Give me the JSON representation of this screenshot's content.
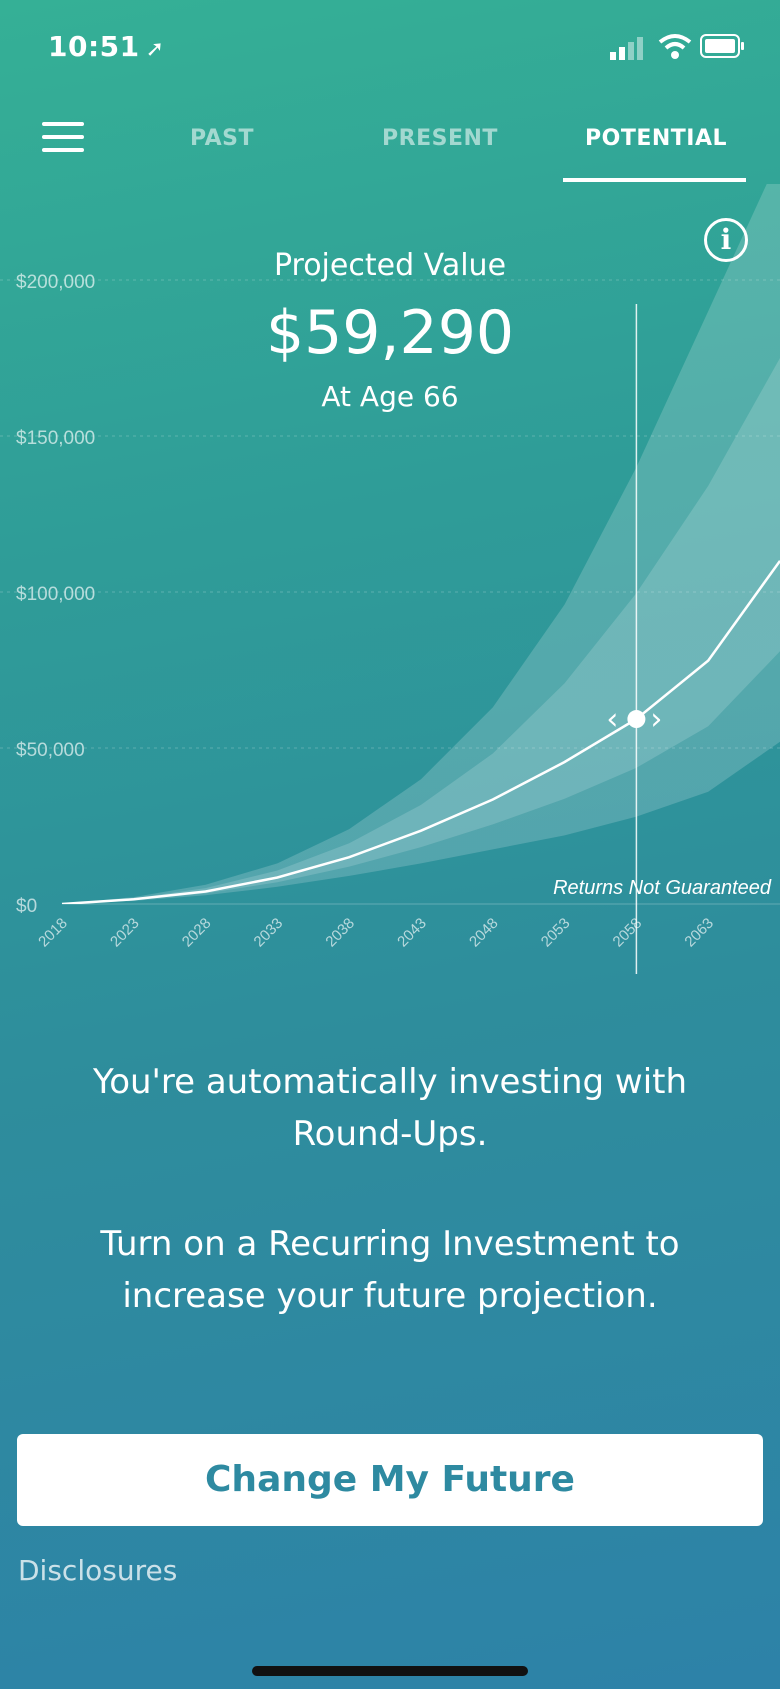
{
  "status_bar": {
    "time": "10:51"
  },
  "nav": {
    "tabs": [
      {
        "label": "PAST",
        "active": false
      },
      {
        "label": "PRESENT",
        "active": false
      },
      {
        "label": "POTENTIAL",
        "active": true
      }
    ]
  },
  "projection": {
    "label": "Projected Value",
    "value": "$59,290",
    "age_text": "At Age 66"
  },
  "chart_data": {
    "type": "area",
    "x_ticks": [
      "2018",
      "2023",
      "2028",
      "2033",
      "2038",
      "2043",
      "2048",
      "2053",
      "2058",
      "2063"
    ],
    "y_ticks": [
      "$0",
      "$50,000",
      "$100,000",
      "$150,000",
      "$200,000"
    ],
    "y_tick_values": [
      0,
      50000,
      100000,
      150000,
      200000
    ],
    "ylim": [
      0,
      200000
    ],
    "xlim": [
      2018,
      2068
    ],
    "selected": {
      "year": 2058,
      "value": 59290
    },
    "annotation": "Returns Not Guaranteed",
    "series": [
      {
        "x": [
          2018,
          2023,
          2028,
          2033,
          2038,
          2043,
          2048,
          2053,
          2058,
          2063,
          2068
        ],
        "values": [
          0,
          1500,
          4000,
          8500,
          15000,
          23500,
          33500,
          45500,
          59290,
          78000,
          110000
        ]
      },
      {
        "x": [
          2018,
          2023,
          2028,
          2033,
          2038,
          2043,
          2048,
          2053,
          2058,
          2063,
          2068
        ],
        "values": [
          0,
          1000,
          2800,
          5500,
          9000,
          13000,
          17500,
          22000,
          28000,
          36000,
          52000
        ]
      },
      {
        "x": [
          2018,
          2023,
          2028,
          2033,
          2038,
          2043,
          2048,
          2053,
          2058,
          2063,
          2068
        ],
        "values": [
          0,
          2200,
          6200,
          13000,
          24000,
          40000,
          63000,
          96000,
          140000,
          190000,
          240000
        ]
      }
    ]
  },
  "messages": {
    "line1": "You're automatically investing with Round-Ups.",
    "line2": "Turn on a Recurring Investment to increase your future projection."
  },
  "cta_label": "Change My Future",
  "disclosures_label": "Disclosures",
  "colors": {
    "cta_text": "#2e8aa1",
    "accent": "#35b096"
  }
}
